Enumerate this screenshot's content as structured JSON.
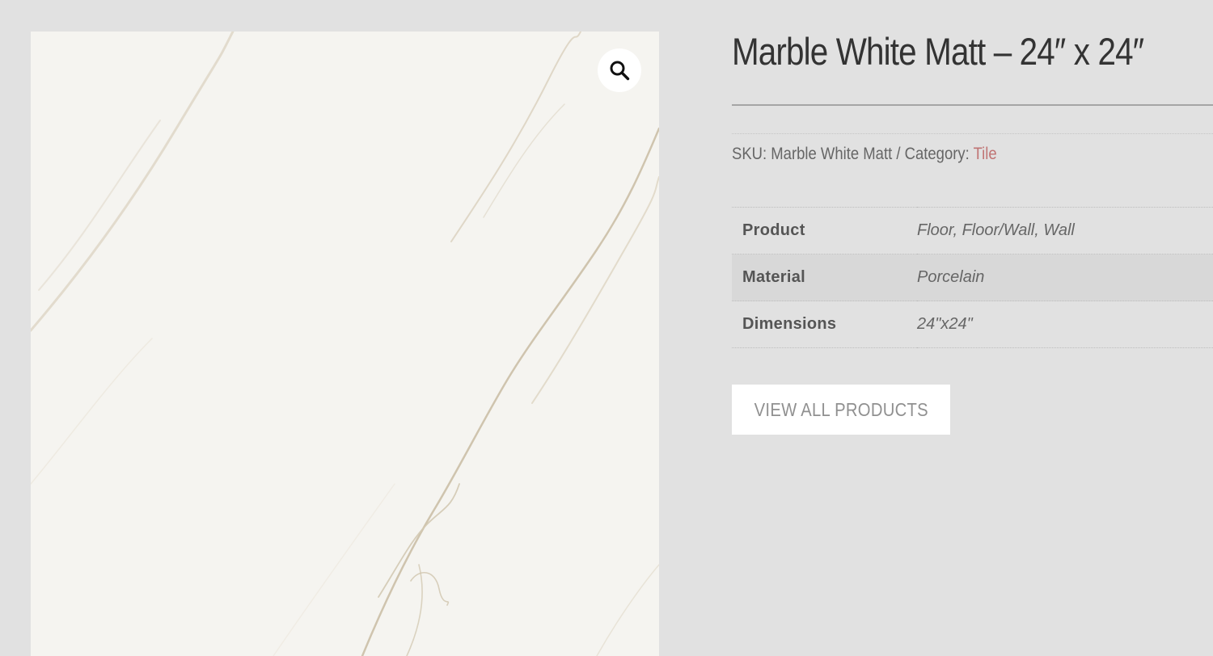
{
  "product": {
    "title": "Marble White Matt – 24″ x 24″",
    "sku_label": "SKU:",
    "sku_value": "Marble White Matt",
    "separator": "/",
    "category_label": "Category:",
    "category_value": "Tile"
  },
  "attributes": [
    {
      "label": "Product",
      "value": "Floor, Floor/Wall, Wall"
    },
    {
      "label": "Material",
      "value": "Porcelain"
    },
    {
      "label": "Dimensions",
      "value": "24\"x24\""
    }
  ],
  "actions": {
    "view_all_label": "VIEW ALL PRODUCTS"
  },
  "gallery": {
    "zoom_icon": "magnifier-icon",
    "image_subject": "marble tile"
  },
  "colors": {
    "page_background": "#e1e1e1",
    "category_link": "#c07474",
    "tile_background": "#f5f4f0"
  }
}
